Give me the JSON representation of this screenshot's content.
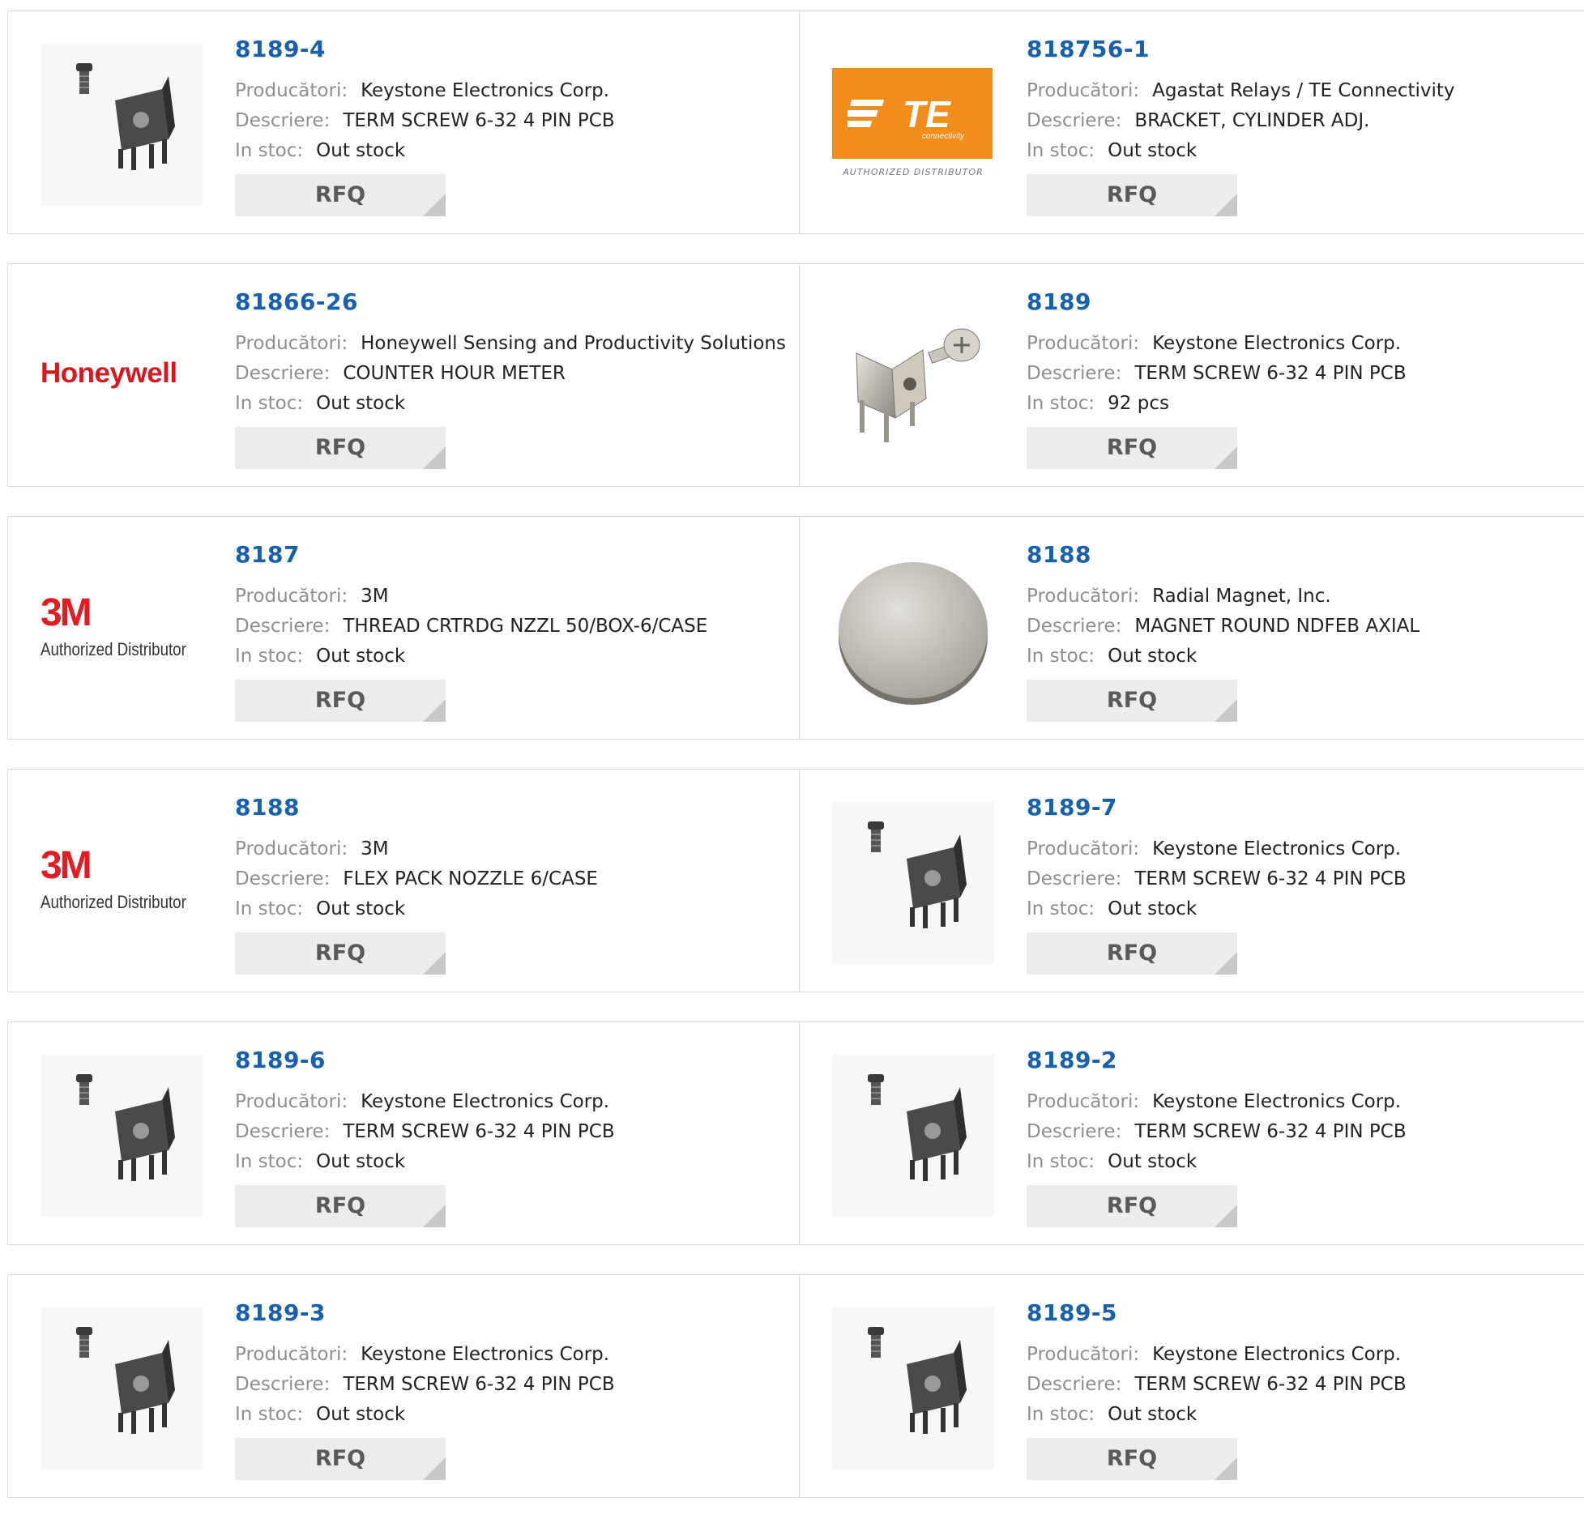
{
  "labels": {
    "manufacturer": "Producători:",
    "description": "Descriere:",
    "stock": "In stoc:",
    "rfq": "RFQ"
  },
  "products": [
    {
      "part_number": "8189-4",
      "manufacturer": "Keystone Electronics Corp.",
      "description": "TERM SCREW 6-32 4 PIN PCB",
      "stock": "Out stock",
      "image": "screw-terminal-icon"
    },
    {
      "part_number": "818756-1",
      "manufacturer": "Agastat Relays / TE Connectivity",
      "description": "BRACKET, CYLINDER ADJ.",
      "stock": "Out stock",
      "image": "te-logo",
      "logo_text": "TE",
      "logo_subtext": "connectivity",
      "logo_caption": "AUTHORIZED DISTRIBUTOR"
    },
    {
      "part_number": "81866-26",
      "manufacturer": "Honeywell Sensing and Productivity Solutions",
      "description": "COUNTER HOUR METER",
      "stock": "Out stock",
      "image": "honeywell-logo",
      "logo_text": "Honeywell"
    },
    {
      "part_number": "8189",
      "manufacturer": "Keystone Electronics Corp.",
      "description": "TERM SCREW 6-32 4 PIN PCB",
      "stock": "92 pcs",
      "image": "silver-terminal-icon"
    },
    {
      "part_number": "8187",
      "manufacturer": "3M",
      "description": "THREAD CRTRDG NZZL 50/BOX-6/CASE",
      "stock": "Out stock",
      "image": "3m-logo",
      "logo_text": "3M",
      "logo_caption": "Authorized Distributor"
    },
    {
      "part_number": "8188",
      "manufacturer": "Radial Magnet, Inc.",
      "description": "MAGNET ROUND NDFEB AXIAL",
      "stock": "Out stock",
      "image": "round-magnet-icon"
    },
    {
      "part_number": "8188",
      "manufacturer": "3M",
      "description": "FLEX PACK NOZZLE 6/CASE",
      "stock": "Out stock",
      "image": "3m-logo",
      "logo_text": "3M",
      "logo_caption": "Authorized Distributor"
    },
    {
      "part_number": "8189-7",
      "manufacturer": "Keystone Electronics Corp.",
      "description": "TERM SCREW 6-32 4 PIN PCB",
      "stock": "Out stock",
      "image": "screw-terminal-icon"
    },
    {
      "part_number": "8189-6",
      "manufacturer": "Keystone Electronics Corp.",
      "description": "TERM SCREW 6-32 4 PIN PCB",
      "stock": "Out stock",
      "image": "screw-terminal-icon"
    },
    {
      "part_number": "8189-2",
      "manufacturer": "Keystone Electronics Corp.",
      "description": "TERM SCREW 6-32 4 PIN PCB",
      "stock": "Out stock",
      "image": "screw-terminal-icon"
    },
    {
      "part_number": "8189-3",
      "manufacturer": "Keystone Electronics Corp.",
      "description": "TERM SCREW 6-32 4 PIN PCB",
      "stock": "Out stock",
      "image": "screw-terminal-icon"
    },
    {
      "part_number": "8189-5",
      "manufacturer": "Keystone Electronics Corp.",
      "description": "TERM SCREW 6-32 4 PIN PCB",
      "stock": "Out stock",
      "image": "screw-terminal-icon"
    }
  ],
  "colors": {
    "part_link": "#1760ad",
    "honeywell_red": "#d7191f",
    "te_orange": "#f28d1c",
    "3m_red": "#e31b23",
    "rfq_bg": "#ececec"
  }
}
